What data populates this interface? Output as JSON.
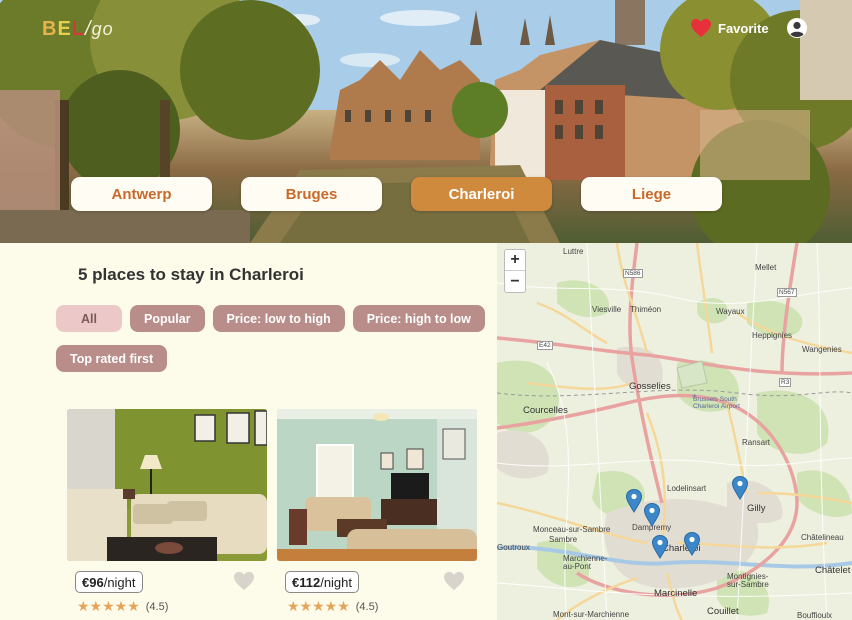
{
  "header": {
    "logo": {
      "b": "B",
      "e": "E",
      "l": "L",
      "slash": "/",
      "go": "go"
    },
    "favorite_label": "Favorite",
    "favorite_icon": "heart-icon",
    "user_icon": "user-icon"
  },
  "cities": [
    {
      "label": "Antwerp",
      "active": false
    },
    {
      "label": "Bruges",
      "active": false
    },
    {
      "label": "Charleroi",
      "active": true
    },
    {
      "label": "Liege",
      "active": false
    }
  ],
  "listing": {
    "heading": "5 places to stay in Charleroi",
    "filters": [
      "All",
      "Popular",
      "Price: low to high",
      "Price: high to low",
      "Top rated first"
    ],
    "active_filter": "All",
    "cards": [
      {
        "price": "€96",
        "unit": "/night",
        "stars": "★★★★★",
        "rating": "(4.5)",
        "rating_value": 4.5
      },
      {
        "price": "€112",
        "unit": "/night",
        "stars": "★★★★★",
        "rating": "(4.5)",
        "rating_value": 4.5
      }
    ]
  },
  "map": {
    "zoom_in": "+",
    "zoom_out": "−",
    "places": [
      "Luttre",
      "Mellet",
      "Viesville",
      "Thiméon",
      "Wayaux",
      "Heppignies",
      "Wangenies",
      "Gosselies",
      "Courcelles",
      "Brussels South Charleroi Airport",
      "Ransart",
      "Lodelinsart",
      "Gilly",
      "Dampremy",
      "Charleroi",
      "Monceau-sur-Sambre",
      "Marchienne-au-Pont",
      "Marcinelle",
      "Châtelet",
      "Châtelineau",
      "Montignies-sur-Sambre",
      "Couillet",
      "Mont-sur-Marchienne",
      "Bouffioulx",
      "Goutroux",
      "Sambre"
    ],
    "roads": [
      "N586",
      "N567",
      "E42",
      "R3"
    ],
    "colors": {
      "road_major": "#e8a3a0",
      "road_minor": "#f5d79a",
      "green": "#cfe3b5",
      "urban": "#e2ddd3",
      "pin": "#3b87c9"
    }
  }
}
